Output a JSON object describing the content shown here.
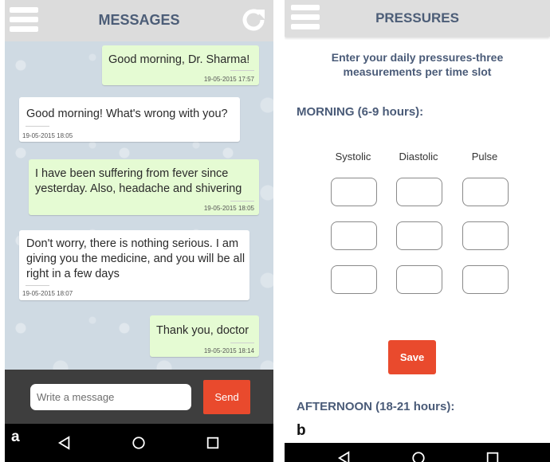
{
  "messages_screen": {
    "title": "MESSAGES",
    "icons": {
      "menu": "hamburger-menu-icon",
      "refresh": "refresh-icon"
    },
    "messages": [
      {
        "direction": "outgoing",
        "text": "Good morning, Dr. Sharma!",
        "time": "19-05-2015 17:57"
      },
      {
        "direction": "incoming",
        "text": "Good morning! What's wrong with you?",
        "time": "19-05-2015 18:05"
      },
      {
        "direction": "outgoing",
        "text": "I have been suffering from fever since yesterday. Also, headache and shivering",
        "time": "19-05-2015 18:05"
      },
      {
        "direction": "incoming",
        "text": "Don't worry, there is nothing serious. I am giving you the medicine, and you will be all right in a few days",
        "time": "19-05-2015 18:07"
      },
      {
        "direction": "outgoing",
        "text": "Thank you, doctor",
        "time": "19-05-2015 18:14"
      }
    ],
    "composer": {
      "placeholder": "Write a message",
      "value": "",
      "send_label": "Send"
    },
    "panel_label": "a"
  },
  "pressures_screen": {
    "title": "PRESSURES",
    "instructions": "Enter your daily pressures-three measurements per time slot",
    "sections": [
      {
        "title": "MORNING (6-9 hours):"
      },
      {
        "title": "AFTERNOON (18-21 hours):"
      }
    ],
    "columns": [
      "Systolic",
      "Diastolic",
      "Pulse"
    ],
    "rows": 3,
    "save_label": "Save",
    "panel_label": "b"
  },
  "navbar": {
    "icons": [
      "back-icon",
      "home-icon",
      "recent-apps-icon"
    ]
  },
  "colors": {
    "header_text": "#4c5d77",
    "accent": "#e94a2d",
    "outgoing_bubble": "#e5fbd3",
    "incoming_bubble": "#ffffff",
    "chat_bg": "#cfdae3"
  }
}
